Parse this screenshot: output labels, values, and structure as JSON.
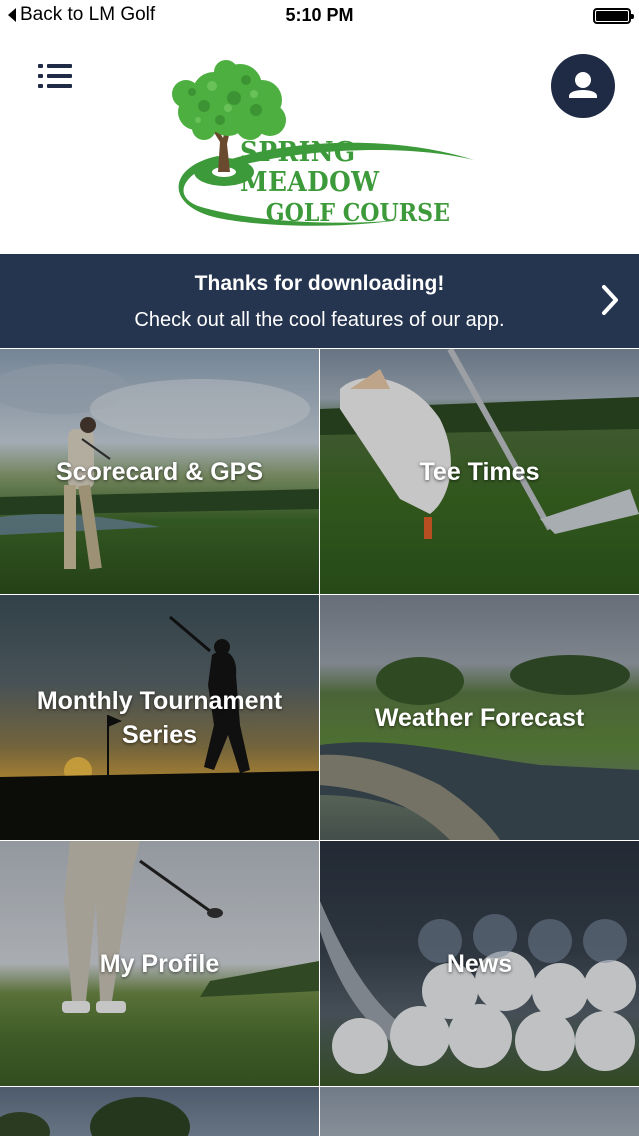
{
  "status_bar": {
    "back_label": "Back to LM Golf",
    "time": "5:10 PM"
  },
  "header": {
    "logo_line1": "SPRING MEADOW",
    "logo_line2": "GOLF COURSE",
    "menu_icon": "list-menu-icon",
    "profile_icon": "user-icon"
  },
  "banner": {
    "title": "Thanks for downloading!",
    "subtitle": "Check out all the cool features of our app.",
    "arrow_icon": "chevron-right-icon"
  },
  "tiles": [
    {
      "label": "Scorecard & GPS"
    },
    {
      "label": "Tee Times"
    },
    {
      "label": "Monthly Tournament Series"
    },
    {
      "label": "Weather Forecast"
    },
    {
      "label": "My Profile"
    },
    {
      "label": "News"
    }
  ],
  "colors": {
    "navy": "#1f2b45",
    "banner": "#26354f",
    "logo_green": "#3d9a3a"
  }
}
